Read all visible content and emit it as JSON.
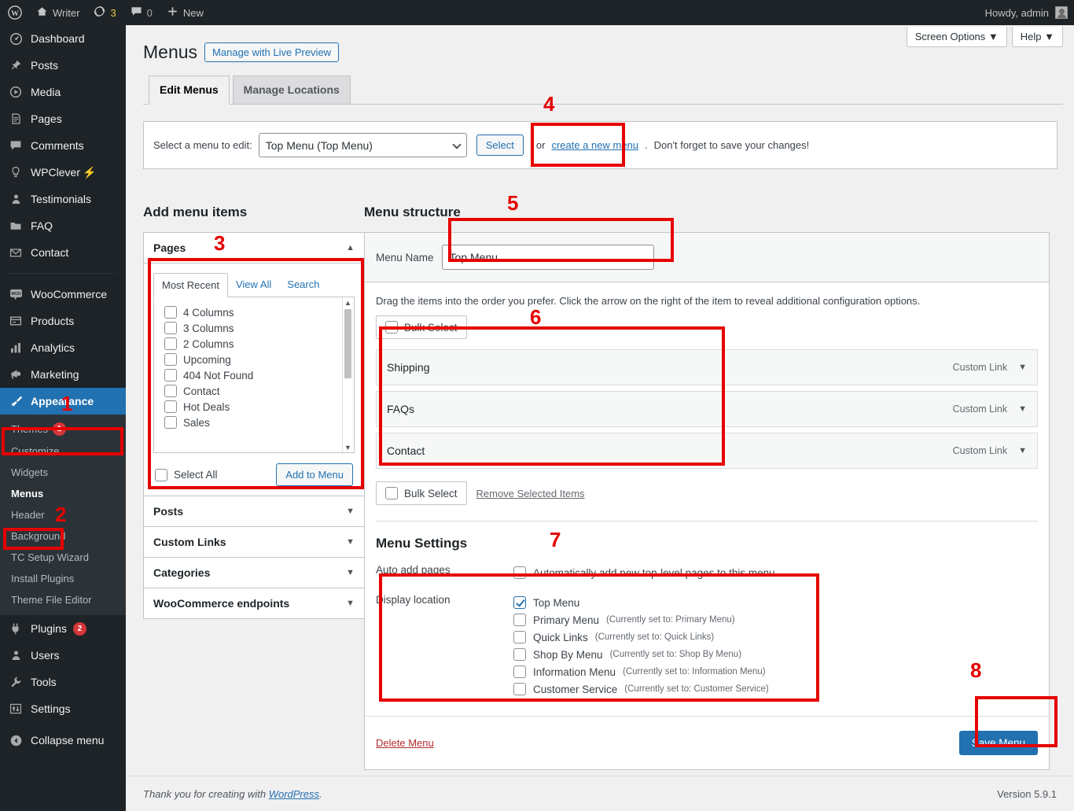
{
  "adminbar": {
    "logo_icon": "wordpress-logo-icon",
    "site_name": "Writer",
    "site_icon": "home-icon",
    "updates_icon": "updates-icon",
    "updates_count": "3",
    "comments_icon": "comment-icon",
    "comments_count": "0",
    "new_icon": "plus-icon",
    "new_label": "New",
    "howdy": "Howdy, admin",
    "avatar_icon": "avatar-icon"
  },
  "sidebar": {
    "items": [
      {
        "label": "Dashboard",
        "icon": "dashboard-icon"
      },
      {
        "label": "Posts",
        "icon": "pin-icon"
      },
      {
        "label": "Media",
        "icon": "media-icon"
      },
      {
        "label": "Pages",
        "icon": "page-icon"
      },
      {
        "label": "Comments",
        "icon": "comment-icon"
      },
      {
        "label": "WPClever",
        "icon": "lightbulb-icon",
        "suffix": "⚡"
      },
      {
        "label": "Testimonials",
        "icon": "user-icon"
      },
      {
        "label": "FAQ",
        "icon": "folder-icon"
      },
      {
        "label": "Contact",
        "icon": "envelope-icon"
      },
      {
        "label": "WooCommerce",
        "icon": "woo-icon"
      },
      {
        "label": "Products",
        "icon": "products-icon"
      },
      {
        "label": "Analytics",
        "icon": "bar-chart-icon"
      },
      {
        "label": "Marketing",
        "icon": "megaphone-icon"
      },
      {
        "label": "Appearance",
        "icon": "paintbrush-icon",
        "current": true
      }
    ],
    "appearance_submenu": [
      {
        "label": "Themes",
        "badge": "1"
      },
      {
        "label": "Customize"
      },
      {
        "label": "Widgets"
      },
      {
        "label": "Menus",
        "current": true
      },
      {
        "label": "Header"
      },
      {
        "label": "Background"
      },
      {
        "label": "TC Setup Wizard"
      },
      {
        "label": "Install Plugins"
      },
      {
        "label": "Theme File Editor"
      }
    ],
    "items_bottom": [
      {
        "label": "Plugins",
        "icon": "plug-icon",
        "badge": "2"
      },
      {
        "label": "Users",
        "icon": "users-icon"
      },
      {
        "label": "Tools",
        "icon": "wrench-icon"
      },
      {
        "label": "Settings",
        "icon": "sliders-icon"
      }
    ],
    "collapse": {
      "label": "Collapse menu",
      "icon": "collapse-arrow-icon"
    }
  },
  "screen_meta": {
    "screen_options": "Screen Options ▼",
    "help": "Help ▼"
  },
  "header": {
    "title": "Menus",
    "live_preview_button": "Manage with Live Preview",
    "tabs": [
      {
        "label": "Edit Menus",
        "active": true
      },
      {
        "label": "Manage Locations",
        "active": false
      }
    ]
  },
  "menu_selector": {
    "label": "Select a menu to edit:",
    "selected": "Top Menu (Top Menu)",
    "options": [
      "Top Menu (Top Menu)"
    ],
    "select_button": "Select",
    "or_text": "or",
    "create_link": "create a new menu",
    "period": ".",
    "reminder": "Don't forget to save your changes!"
  },
  "add_menu_items": {
    "title": "Add menu items",
    "panels": [
      {
        "label": "Pages",
        "open": true
      },
      {
        "label": "Posts",
        "open": false
      },
      {
        "label": "Custom Links",
        "open": false
      },
      {
        "label": "Categories",
        "open": false
      },
      {
        "label": "WooCommerce endpoints",
        "open": false
      }
    ],
    "pages_tabs": [
      {
        "label": "Most Recent",
        "active": true
      },
      {
        "label": "View All",
        "active": false
      },
      {
        "label": "Search",
        "active": false
      }
    ],
    "pages": [
      {
        "label": "4 Columns",
        "checked": false
      },
      {
        "label": "3 Columns",
        "checked": false
      },
      {
        "label": "2 Columns",
        "checked": false
      },
      {
        "label": "Upcoming",
        "checked": false
      },
      {
        "label": "404 Not Found",
        "checked": false
      },
      {
        "label": "Contact",
        "checked": false
      },
      {
        "label": "Hot Deals",
        "checked": false
      },
      {
        "label": "Sales",
        "checked": false
      }
    ],
    "select_all": "Select All",
    "add_to_menu": "Add to Menu"
  },
  "menu_structure": {
    "title": "Menu structure",
    "name_label": "Menu Name",
    "name_value": "Top Menu",
    "drag_hint": "Drag the items into the order you prefer. Click the arrow on the right of the item to reveal additional configuration options.",
    "bulk_select_top": "Bulk Select",
    "bulk_select_bottom": "Bulk Select",
    "remove_selected": "Remove Selected Items",
    "items": [
      {
        "label": "Shipping",
        "type": "Custom Link"
      },
      {
        "label": "FAQs",
        "type": "Custom Link"
      },
      {
        "label": "Contact",
        "type": "Custom Link"
      }
    ]
  },
  "menu_settings": {
    "title": "Menu Settings",
    "auto_add_key": "Auto add pages",
    "auto_add_option": "Automatically add new top-level pages to this menu",
    "auto_add_checked": false,
    "display_location_key": "Display location",
    "locations": [
      {
        "label": "Top Menu",
        "note": "",
        "checked": true
      },
      {
        "label": "Primary Menu",
        "note": "(Currently set to: Primary Menu)",
        "checked": false
      },
      {
        "label": "Quick Links",
        "note": "(Currently set to: Quick Links)",
        "checked": false
      },
      {
        "label": "Shop By Menu",
        "note": "(Currently set to: Shop By Menu)",
        "checked": false
      },
      {
        "label": "Information Menu",
        "note": "(Currently set to: Information Menu)",
        "checked": false
      },
      {
        "label": "Customer Service",
        "note": "(Currently set to: Customer Service)",
        "checked": false
      }
    ]
  },
  "actions": {
    "delete_menu": "Delete Menu",
    "save_menu": "Save Menu"
  },
  "footer": {
    "thanks_prefix": "Thank you for creating with ",
    "wordpress_link": "WordPress",
    "thanks_suffix": ".",
    "version": "Version 5.9.1"
  },
  "annotations": {
    "color": "#e60000",
    "numbers": [
      "1",
      "2",
      "3",
      "4",
      "5",
      "6",
      "7",
      "8"
    ]
  }
}
